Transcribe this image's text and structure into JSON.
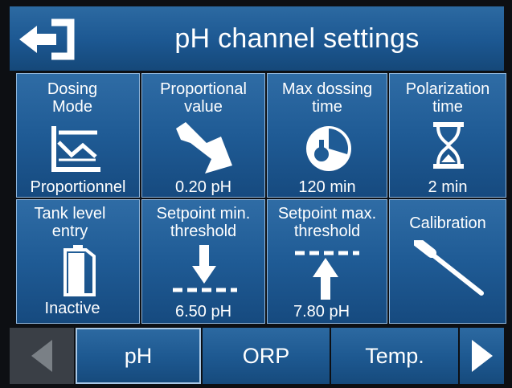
{
  "header": {
    "title": "pH channel settings",
    "back_icon": "exit-arrow-icon"
  },
  "tiles": [
    {
      "label": "Dosing\nMode",
      "value": "Proportionnel",
      "icon": "proportional-graph-icon"
    },
    {
      "label": "Proportional\nvalue",
      "value": "0.20 pH",
      "icon": "diagonal-down-arrow-icon"
    },
    {
      "label": "Max dossing\ntime",
      "value": "120 min",
      "icon": "clock-flask-icon"
    },
    {
      "label": "Polarization\ntime",
      "value": "2 min",
      "icon": "hourglass-icon"
    },
    {
      "label": "Tank level\nentry",
      "value": "Inactive",
      "icon": "tank-icon"
    },
    {
      "label": "Setpoint min.\nthreshold",
      "value": "6.50 pH",
      "icon": "arrow-down-threshold-icon"
    },
    {
      "label": "Setpoint max.\nthreshold",
      "value": "7.80 pH",
      "icon": "arrow-up-threshold-icon"
    },
    {
      "label": "Calibration",
      "value": "",
      "icon": "probe-icon"
    }
  ],
  "tabs": {
    "items": [
      "pH",
      "ORP",
      "Temp."
    ],
    "active": "pH"
  },
  "colors": {
    "tile_top": "#2f6ca5",
    "tile_bottom": "#164a7f",
    "border": "#8fb6dc",
    "background": "#0d0f13"
  }
}
